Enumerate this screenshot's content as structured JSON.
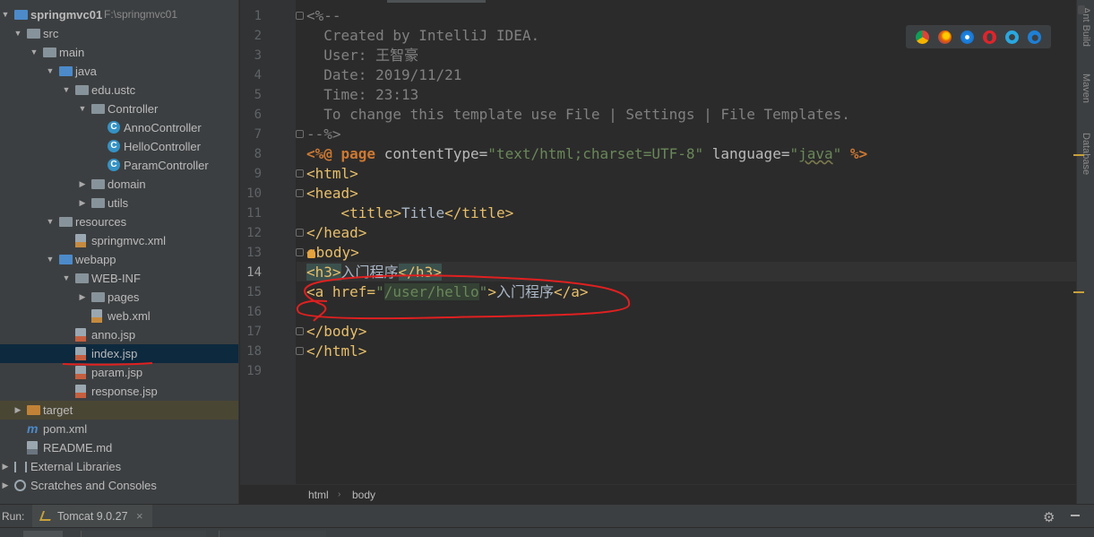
{
  "project": {
    "items": [
      {
        "label": "springmvc01",
        "path": "F:\\springmvc01",
        "icon": "module-folder-icon",
        "depth": 0,
        "arrow": "down"
      },
      {
        "label": "src",
        "icon": "folder-icon",
        "depth": 1,
        "arrow": "down"
      },
      {
        "label": "main",
        "icon": "folder-icon",
        "depth": 2,
        "arrow": "down"
      },
      {
        "label": "java",
        "icon": "source-folder-icon",
        "depth": 3,
        "arrow": "down"
      },
      {
        "label": "edu.ustc",
        "icon": "package-icon",
        "depth": 4,
        "arrow": "down"
      },
      {
        "label": "Controller",
        "icon": "package-icon",
        "depth": 5,
        "arrow": "down"
      },
      {
        "label": "AnnoController",
        "icon": "class-icon",
        "depth": 6,
        "arrow": ""
      },
      {
        "label": "HelloController",
        "icon": "class-icon",
        "depth": 6,
        "arrow": ""
      },
      {
        "label": "ParamController",
        "icon": "class-icon",
        "depth": 6,
        "arrow": ""
      },
      {
        "label": "domain",
        "icon": "package-icon",
        "depth": 5,
        "arrow": "right"
      },
      {
        "label": "utils",
        "icon": "package-icon",
        "depth": 5,
        "arrow": "right"
      },
      {
        "label": "resources",
        "icon": "resources-folder-icon",
        "depth": 3,
        "arrow": "down"
      },
      {
        "label": "springmvc.xml",
        "icon": "xml-file-icon",
        "depth": 4,
        "arrow": ""
      },
      {
        "label": "webapp",
        "icon": "web-folder-icon",
        "depth": 3,
        "arrow": "down"
      },
      {
        "label": "WEB-INF",
        "icon": "folder-icon",
        "depth": 4,
        "arrow": "down"
      },
      {
        "label": "pages",
        "icon": "folder-icon",
        "depth": 5,
        "arrow": "right"
      },
      {
        "label": "web.xml",
        "icon": "xml-file-icon",
        "depth": 5,
        "arrow": ""
      },
      {
        "label": "anno.jsp",
        "icon": "jsp-file-icon",
        "depth": 4,
        "arrow": ""
      },
      {
        "label": "index.jsp",
        "icon": "jsp-file-icon",
        "depth": 4,
        "arrow": "",
        "selected": true
      },
      {
        "label": "param.jsp",
        "icon": "jsp-file-icon",
        "depth": 4,
        "arrow": ""
      },
      {
        "label": "response.jsp",
        "icon": "jsp-file-icon",
        "depth": 4,
        "arrow": ""
      },
      {
        "label": "target",
        "icon": "excluded-folder-icon",
        "depth": 1,
        "arrow": "right",
        "excluded": true
      },
      {
        "label": "pom.xml",
        "icon": "maven-icon",
        "depth": 1,
        "arrow": ""
      },
      {
        "label": "README.md",
        "icon": "markdown-file-icon",
        "depth": 1,
        "arrow": ""
      },
      {
        "label": "External Libraries",
        "icon": "libraries-icon",
        "depth": 0,
        "arrow": "right"
      },
      {
        "label": "Scratches and Consoles",
        "icon": "scratches-icon",
        "depth": 0,
        "arrow": "right"
      }
    ]
  },
  "editor": {
    "current_line": 14,
    "line_numbers": [
      "1",
      "2",
      "3",
      "4",
      "5",
      "6",
      "7",
      "8",
      "9",
      "10",
      "11",
      "12",
      "13",
      "14",
      "15",
      "16",
      "17",
      "18",
      "19"
    ],
    "lines": {
      "l1": "<%--",
      "l2": "  Created by IntelliJ IDEA.",
      "l3": "  User: 王智豪",
      "l4": "  Date: 2019/11/21",
      "l5": "  Time: 23:13",
      "l6": "  To change this template use File | Settings | File Templates.",
      "l7": "--%>",
      "l8": {
        "open": "<%@ ",
        "kw": "page",
        "attr1": " contentType=",
        "val1": "\"text/html;charset=UTF-8\"",
        "attr2": " language=",
        "val2q1": "\"",
        "val2": "java",
        "val2q2": "\"",
        "close": " %>"
      },
      "l9": "<html>",
      "l10": "<head>",
      "l11": {
        "indent": "    ",
        "open": "<title>",
        "text": "Title",
        "close": "</title>"
      },
      "l12": "</head>",
      "l13a": "<",
      "l13b": "body>",
      "l14": {
        "open": "<h3>",
        "text": "入门程序",
        "close": "</h3>"
      },
      "l15": {
        "open": "<a href=",
        "q1": "\"",
        "href": "/user/hello",
        "q2": "\"",
        "gt": ">",
        "text": "入门程序",
        "close": "</a>"
      },
      "l17": "</body>",
      "l18": "</html>"
    }
  },
  "browsers": [
    "chrome-icon",
    "firefox-icon",
    "safari-icon",
    "opera-icon",
    "ie-icon",
    "edge-icon"
  ],
  "breadcrumb": {
    "items": [
      "html",
      "body"
    ]
  },
  "run": {
    "label": "Run:",
    "tab": "Tomcat 9.0.27",
    "close": "×"
  },
  "colors": {
    "accent_selection": "#0d293e",
    "annotation": "#e02020",
    "tag": "#e8bf6a",
    "string": "#6a8759"
  }
}
